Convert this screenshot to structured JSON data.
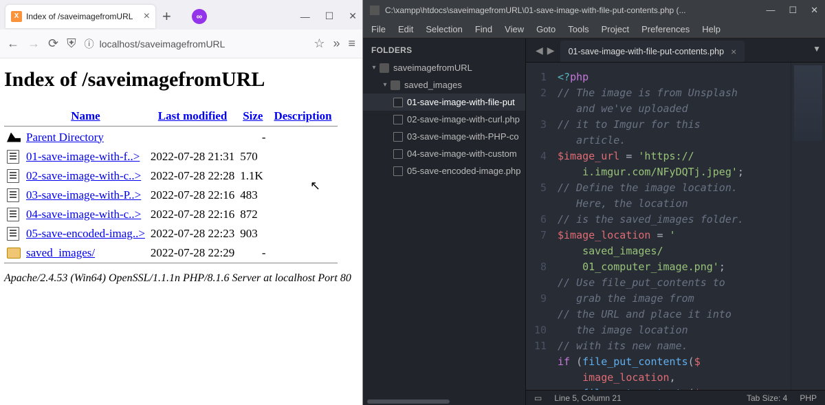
{
  "firefox": {
    "tab_title": "Index of /saveimagefromURL",
    "url_display": "localhost/saveimagefromURL",
    "page_heading": "Index of /saveimagefromURL",
    "headers": {
      "name": "Name",
      "modified": "Last modified",
      "size": "Size",
      "desc": "Description"
    },
    "parent_label": "Parent Directory",
    "rows": [
      {
        "name": "01-save-image-with-f..>",
        "modified": "2022-07-28 21:31",
        "size": "570"
      },
      {
        "name": "02-save-image-with-c..>",
        "modified": "2022-07-28 22:28",
        "size": "1.1K"
      },
      {
        "name": "03-save-image-with-P..>",
        "modified": "2022-07-28 22:16",
        "size": "483"
      },
      {
        "name": "04-save-image-with-c..>",
        "modified": "2022-07-28 22:16",
        "size": "872"
      },
      {
        "name": "05-save-encoded-imag..>",
        "modified": "2022-07-28 22:23",
        "size": "903"
      }
    ],
    "folder_row": {
      "name": "saved_images/",
      "modified": "2022-07-28 22:29",
      "size": "-"
    },
    "footer": "Apache/2.4.53 (Win64) OpenSSL/1.1.1n PHP/8.1.6 Server at localhost Port 80"
  },
  "sublime": {
    "title": "C:\\xampp\\htdocs\\saveimagefromURL\\01-save-image-with-file-put-contents.php (...",
    "menu": [
      "File",
      "Edit",
      "Selection",
      "Find",
      "View",
      "Goto",
      "Tools",
      "Project",
      "Preferences",
      "Help"
    ],
    "sidebar_header": "FOLDERS",
    "tree_root": "saveimagefromURL",
    "tree_folder": "saved_images",
    "tree_files": [
      "01-save-image-with-file-put",
      "02-save-image-with-curl.php",
      "03-save-image-with-PHP-co",
      "04-save-image-with-custom",
      "05-save-encoded-image.php"
    ],
    "open_tab": "01-save-image-with-file-put-contents.php",
    "gutter": [
      "1",
      "2",
      "",
      "3",
      "",
      "4",
      "",
      "5",
      "",
      "6",
      "7",
      "",
      "8",
      "",
      "9",
      "",
      "10",
      "11",
      "",
      "",
      ""
    ],
    "code_lines": [
      "<span class='c-punc'>&lt;?</span><span class='c-tag'>php</span>",
      "<span class='c-comm'>// The image is from Unsplash</span>",
      "<span class='c-comm'>   and we've uploaded</span>",
      "<span class='c-comm'>// it to Imgur for this</span>",
      "<span class='c-comm'>   article.</span>",
      "<span class='c-var'>$image_url</span> <span class='c-op'>=</span> <span class='c-str'>'https://</span>",
      "<span class='c-str'>    i.imgur.com/NFyDQTj.jpeg'</span><span class='c-op'>;</span>",
      "<span class='c-comm'>// Define the image location.</span>",
      "<span class='c-comm'>   Here, the location</span>",
      "<span class='c-comm'>// is the saved_images folder.</span>",
      "<span class='c-var'>$image_location</span> <span class='c-op'>=</span> <span class='c-str'>'</span>",
      "<span class='c-str'>    saved_images/</span>",
      "<span class='c-str'>    01_computer_image.png'</span><span class='c-op'>;</span>",
      "<span class='c-comm'>// Use file_put_contents to</span>",
      "<span class='c-comm'>   grab the image from</span>",
      "<span class='c-comm'>// the URL and place it into</span>",
      "<span class='c-comm'>   the image location</span>",
      "<span class='c-comm'>// with its new name.</span>",
      "<span class='c-kw'>if</span> <span class='c-op'>(</span><span class='c-fn'>file_put_contents</span><span class='c-op'>(</span><span class='c-var'>$</span>",
      "    <span class='c-var'>image_location</span><span class='c-op'>,</span>",
      "    <span class='c-fn'>file_get_contents</span><span class='c-op'>(</span><span class='c-var'>$</span>"
    ],
    "status_cursor": "Line 5, Column 21",
    "status_tab": "Tab Size: 4",
    "status_lang": "PHP"
  }
}
